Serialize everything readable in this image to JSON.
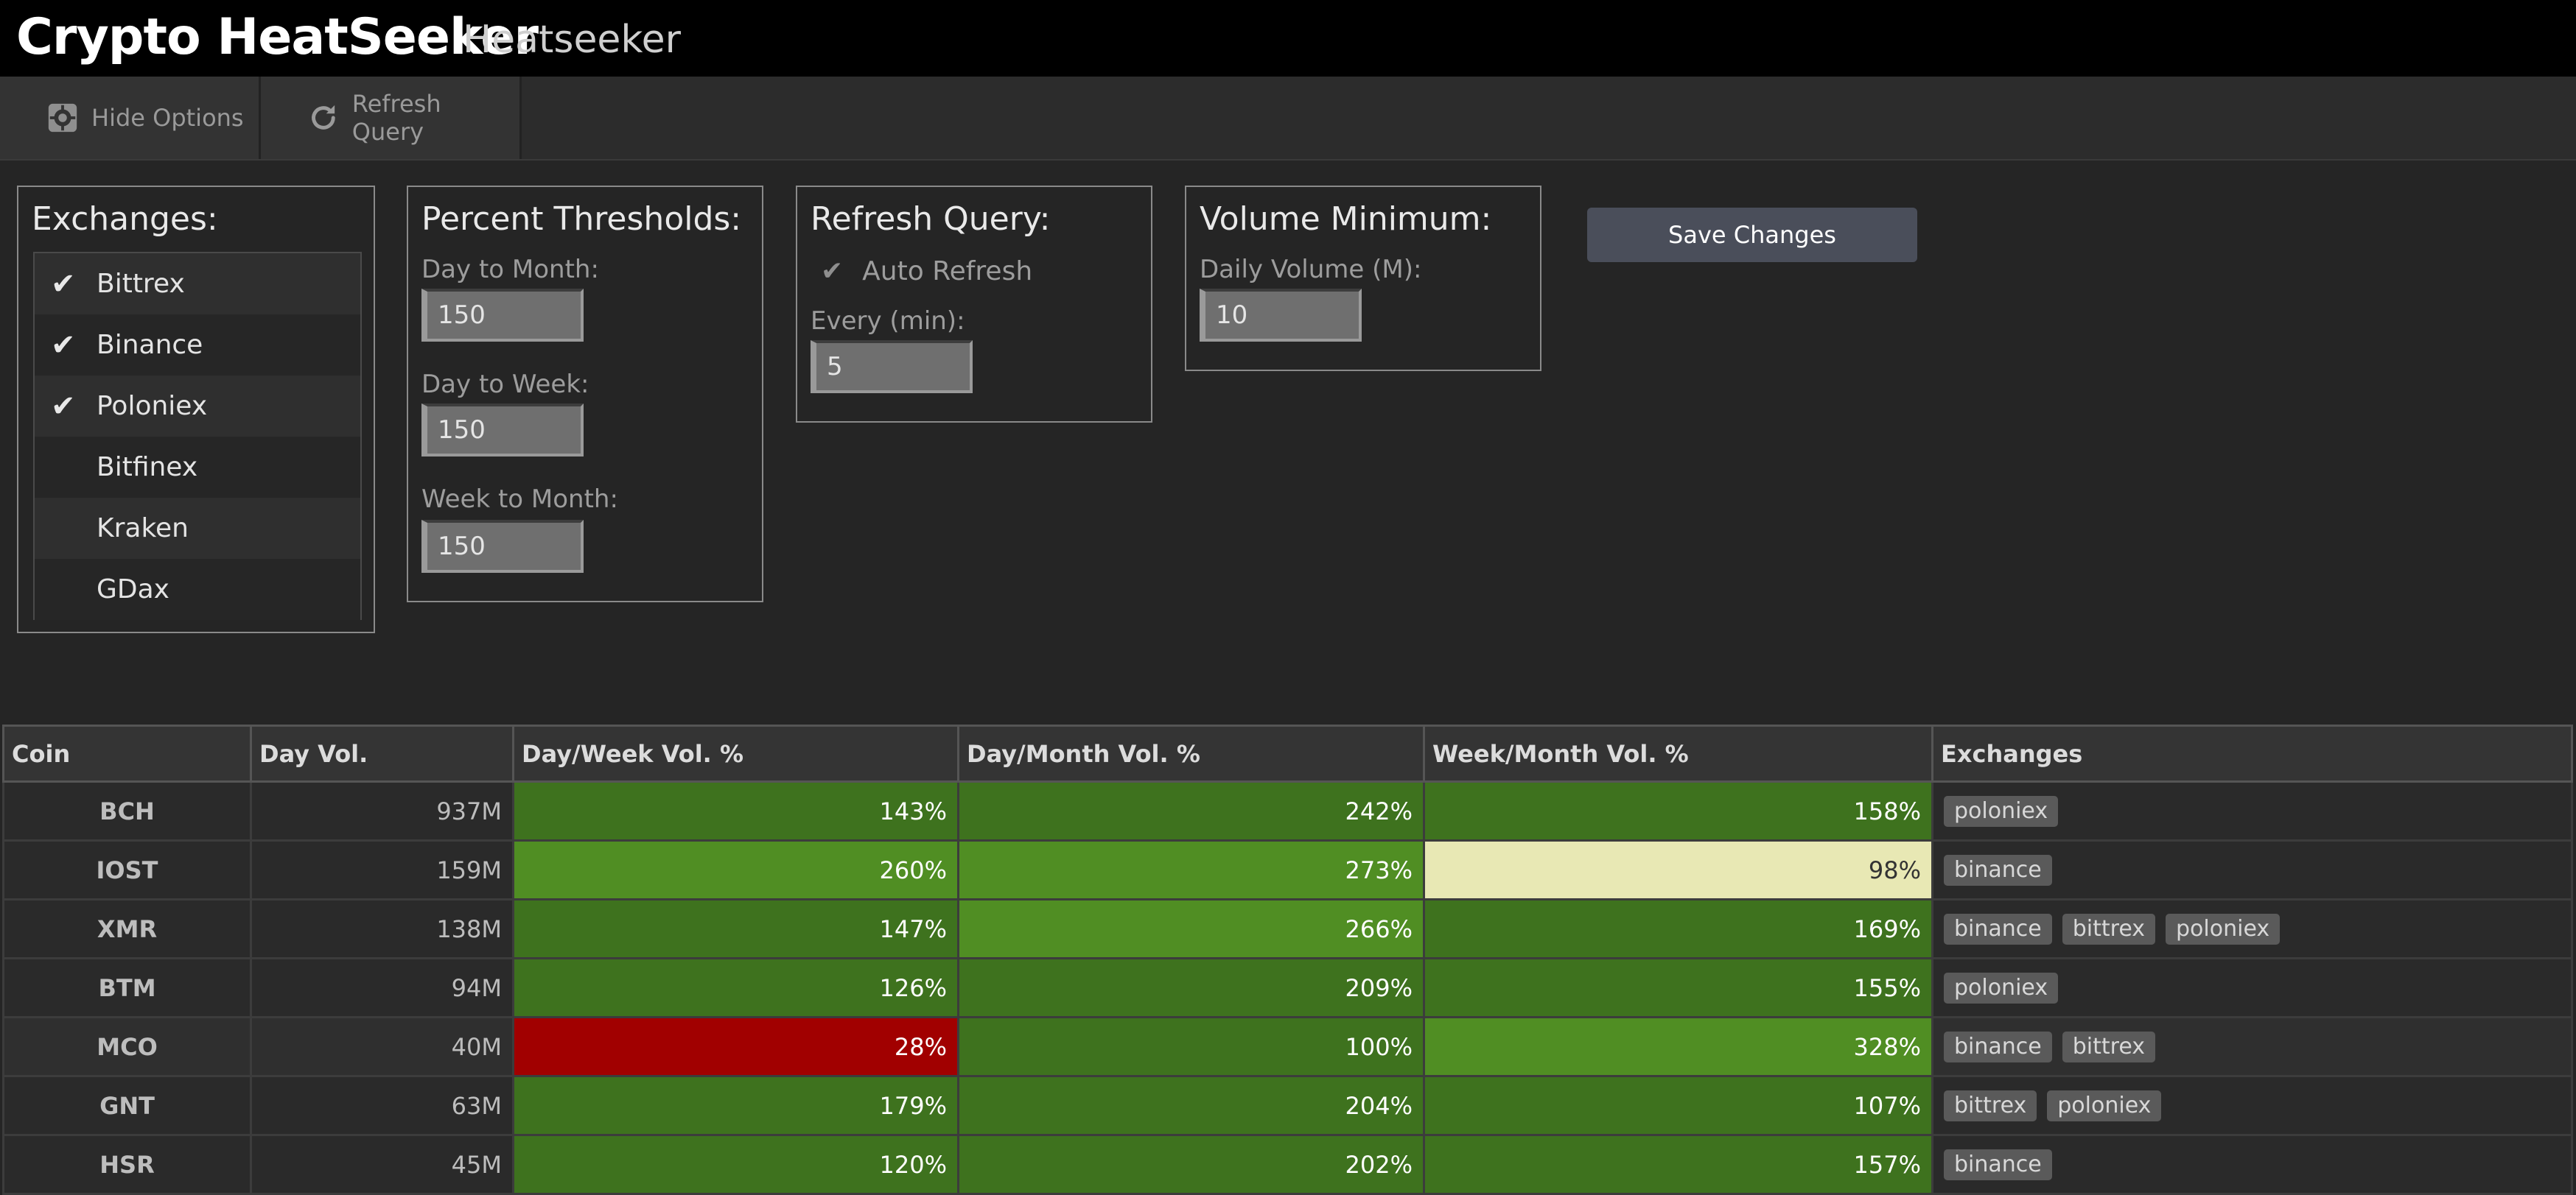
{
  "header": {
    "title": "Crypto HeatSeeker",
    "subtitle": "Heatseeker"
  },
  "toolbar": {
    "hide_options": "Hide Options",
    "refresh_query": "Refresh Query"
  },
  "exchanges_panel": {
    "title": "Exchanges:",
    "items": [
      {
        "label": "Bittrex",
        "checked": true
      },
      {
        "label": "Binance",
        "checked": true
      },
      {
        "label": "Poloniex",
        "checked": true
      },
      {
        "label": "Bitfinex",
        "checked": false
      },
      {
        "label": "Kraken",
        "checked": false
      },
      {
        "label": "GDax",
        "checked": false
      }
    ],
    "check_glyph": "✔"
  },
  "thresholds_panel": {
    "title": "Percent Thresholds:",
    "day_to_month_label": "Day to Month:",
    "day_to_month_value": "150",
    "day_to_week_label": "Day to Week:",
    "day_to_week_value": "150",
    "week_to_month_label": "Week to Month:",
    "week_to_month_value": "150"
  },
  "refresh_panel": {
    "title": "Refresh Query:",
    "auto_refresh_label": "Auto Refresh",
    "every_label": "Every (min):",
    "every_value": "5"
  },
  "volume_panel": {
    "title": "Volume Minimum:",
    "daily_volume_label": "Daily Volume (M):",
    "daily_volume_value": "10"
  },
  "save_button": "Save Changes",
  "table": {
    "headers": [
      "Coin",
      "Day Vol.",
      "Day/Week Vol. %",
      "Day/Month Vol. %",
      "Week/Month Vol. %",
      "Exchanges"
    ],
    "rows": [
      {
        "coin": "BCH",
        "vol": "937M",
        "dw": "143%",
        "dm": "242%",
        "wm": "158%",
        "exchanges": [
          "poloniex"
        ]
      },
      {
        "coin": "IOST",
        "vol": "159M",
        "dw": "260%",
        "dm": "273%",
        "wm": "98%",
        "exchanges": [
          "binance"
        ]
      },
      {
        "coin": "XMR",
        "vol": "138M",
        "dw": "147%",
        "dm": "266%",
        "wm": "169%",
        "exchanges": [
          "binance",
          "bittrex",
          "poloniex"
        ]
      },
      {
        "coin": "BTM",
        "vol": "94M",
        "dw": "126%",
        "dm": "209%",
        "wm": "155%",
        "exchanges": [
          "poloniex"
        ]
      },
      {
        "coin": "MCO",
        "vol": "40M",
        "dw": "28%",
        "dm": "100%",
        "wm": "328%",
        "exchanges": [
          "binance",
          "bittrex"
        ]
      },
      {
        "coin": "GNT",
        "vol": "63M",
        "dw": "179%",
        "dm": "204%",
        "wm": "107%",
        "exchanges": [
          "bittrex",
          "poloniex"
        ]
      },
      {
        "coin": "HSR",
        "vol": "45M",
        "dw": "120%",
        "dm": "202%",
        "wm": "157%",
        "exchanges": [
          "binance"
        ]
      }
    ]
  },
  "colors": {
    "green_dark": "#3e721e",
    "green_light": "#508e23",
    "pale": "#e8e8b4",
    "red": "#a10000"
  }
}
